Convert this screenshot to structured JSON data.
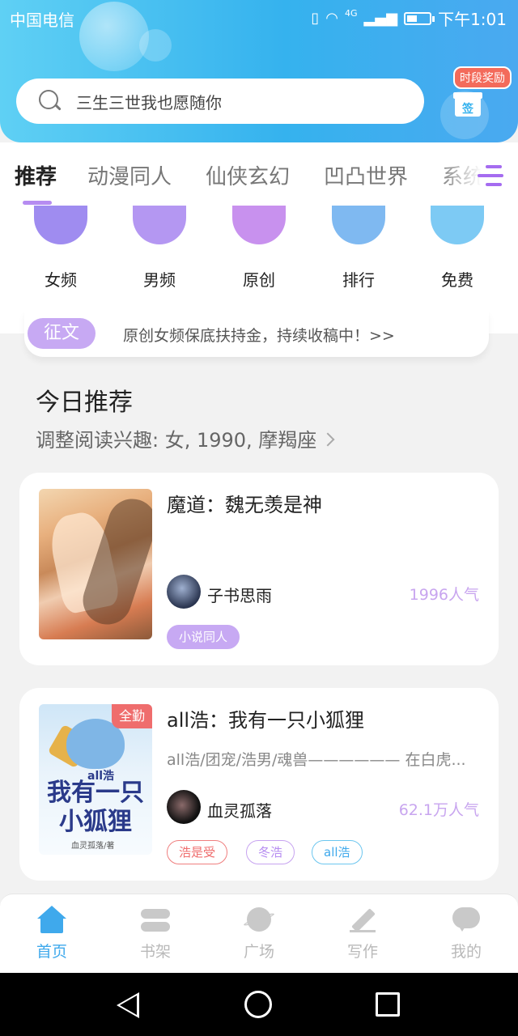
{
  "status_bar": {
    "carrier": "中国电信",
    "signal_label": "4G",
    "time": "下午1:01"
  },
  "search": {
    "placeholder": "三生三世我也愿随你"
  },
  "reward": {
    "badge": "时段奖励",
    "gift_label": "签"
  },
  "tabs": [
    {
      "label": "推荐",
      "active": true
    },
    {
      "label": "动漫同人"
    },
    {
      "label": "仙侠玄幻"
    },
    {
      "label": "凹凸世界"
    },
    {
      "label": "系统"
    }
  ],
  "categories": [
    {
      "label": "女频",
      "icon": "female-channel-icon",
      "color": "#9f8cf0"
    },
    {
      "label": "男频",
      "icon": "male-channel-icon",
      "color": "#b497f2"
    },
    {
      "label": "原创",
      "icon": "original-icon",
      "color": "#c891ee"
    },
    {
      "label": "排行",
      "icon": "ranking-icon",
      "color": "#7fb9f1"
    },
    {
      "label": "免费",
      "icon": "free-icon",
      "color": "#7dcaf4"
    }
  ],
  "notice": {
    "badge": "征文",
    "text": "原创女频保底扶持金，持续收稿中！>>"
  },
  "section": {
    "title": "今日推荐",
    "subtitle": "调整阅读兴趣: 女, 1990, 摩羯座"
  },
  "books": [
    {
      "title": "魔道：魏无羡是神",
      "author": "子书思雨",
      "popularity": "1996人气",
      "tags": [
        {
          "label": "小说同人"
        }
      ]
    },
    {
      "title": "all浩：我有一只小狐狸",
      "description": "all浩/团宠/浩男/魂兽—————— 在白虎...",
      "author": "血灵孤落",
      "popularity": "62.1万人气",
      "badge": "全勤",
      "cover_small": "all浩",
      "cover_title_line1": "我有一只",
      "cover_title_line2": "小狐狸",
      "cover_author": "血灵孤落/著",
      "tags": [
        {
          "label": "浩是受"
        },
        {
          "label": "冬浩"
        },
        {
          "label": "all浩"
        }
      ]
    }
  ],
  "bottom_nav": [
    {
      "label": "首页",
      "icon": "home-icon",
      "active": true
    },
    {
      "label": "书架",
      "icon": "bookshelf-icon"
    },
    {
      "label": "广场",
      "icon": "plaza-icon"
    },
    {
      "label": "写作",
      "icon": "write-icon"
    },
    {
      "label": "我的",
      "icon": "profile-icon"
    }
  ],
  "colors": {
    "header_gradient_start": "#5fd0f4",
    "header_gradient_end": "#4aa9f0",
    "accent_purple": "#b68cf1",
    "active_nav": "#3fa9ec",
    "badge_red": "#ef6d6d"
  }
}
